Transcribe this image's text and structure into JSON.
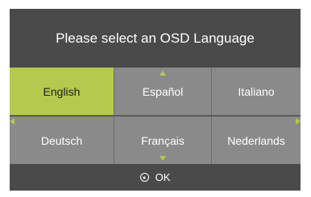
{
  "title": "Please select an OSD Language",
  "selected_language": "English",
  "languages": [
    {
      "label": "English"
    },
    {
      "label": "Español"
    },
    {
      "label": "Italiano"
    },
    {
      "label": "Deutsch"
    },
    {
      "label": "Français"
    },
    {
      "label": "Nederlands"
    }
  ],
  "footer": {
    "ok_label": "OK",
    "ok_icon": "circle-dot-icon"
  },
  "colors": {
    "panel_bg": "#4a4a4a",
    "cell_bg": "#8a8a8a",
    "accent": "#b6c94f"
  }
}
